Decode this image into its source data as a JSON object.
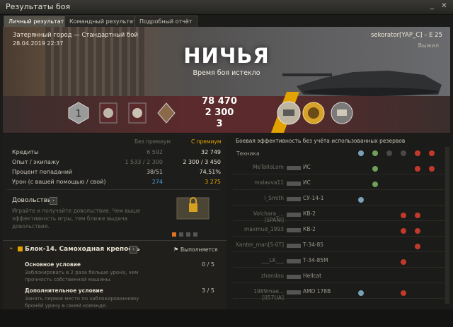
{
  "window": {
    "title": "Результаты боя"
  },
  "tabs": [
    "Личный результат",
    "Командный результат",
    "Подробный отчёт"
  ],
  "hero": {
    "map": "Затерянный город — Стандартный бой",
    "date": "28.04.2019 22:37",
    "result": "НИЧЬЯ",
    "result_sub": "Время боя истекло",
    "player": "sekorator[YAP_C] – E 25",
    "status": "Выжил"
  },
  "earnings": {
    "credits": "78 470",
    "xp": "2 300",
    "free": "3"
  },
  "medals_left": [
    "rank-1-icon",
    "medal-icon",
    "medal-icon",
    "medal-icon"
  ],
  "medals_right": [
    "mastery-badge-icon",
    "medal-icon",
    "medal-icon"
  ],
  "stats": {
    "col_no_premium": "Без премиум",
    "col_premium": "С премиум",
    "rows": [
      {
        "label": "Кредиты",
        "v1": "6 592",
        "v2": "32 749"
      },
      {
        "label": "Опыт / экипажу",
        "v1": "1 533 / 2 300",
        "v2": "2 300 / 3 450"
      },
      {
        "label": "Процент попаданий",
        "v1": "38/51",
        "v2": "74,51%"
      },
      {
        "label": "Урон (с вашей помощью / свой)",
        "v1": "274",
        "v2": "3 275"
      }
    ]
  },
  "satisfaction": {
    "title": "Довольствие",
    "text": "Играйте и получайте довольствие. Чем выше эффективность игры, тем ближе выдача довольствия."
  },
  "quest": {
    "title": "Блок-14. Самоходная крепость",
    "status": "Выполняется",
    "main_title": "Основное условие",
    "main_text": "Заблокировать в 2 раза больше урона, чем прочность собственной машины.",
    "main_progress": "0 / 5",
    "add_title": "Дополнительное условие",
    "add_text": "Занять первое место по заблокированному бронёй урону в своей команде.",
    "add_progress": "3 / 5"
  },
  "efficiency": {
    "title": "Боевая эффективность без учёта использованных резервов",
    "header": "Техника",
    "rows": [
      {
        "player": "MeTaIIoLom",
        "tank": "ИС"
      },
      {
        "player": "malavva11",
        "tank": "ИС"
      },
      {
        "player": "l_Smith",
        "tank": "СУ-14-1"
      },
      {
        "player": "Volchara_...[SPANI]",
        "tank": "КВ-2"
      },
      {
        "player": "maxmud_1993",
        "tank": "КВ-2"
      },
      {
        "player": "Xanter_man[S-0T]",
        "tank": "Т-34-85"
      },
      {
        "player": "___LK___",
        "tank": "Т-34-85M"
      },
      {
        "player": "zhandau",
        "tank": "Hellcat"
      },
      {
        "player": "1989mae...[057UA]",
        "tank": "AMD 178B"
      }
    ]
  }
}
